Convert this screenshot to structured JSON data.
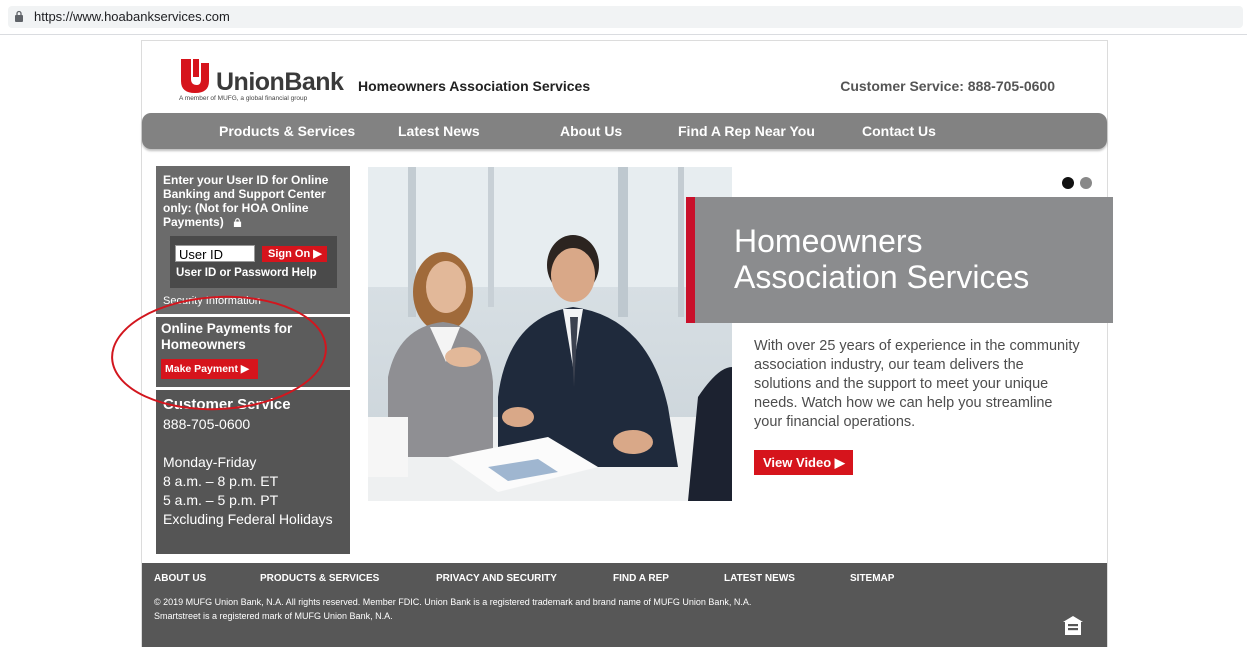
{
  "browser": {
    "url": "https://www.hoabankservices.com"
  },
  "header": {
    "logo_name": "UnionBank",
    "logo_tagline": "A member of MUFG, a global financial group",
    "title": "Homeowners Association Services",
    "customer_service": "Customer Service: 888-705-0600"
  },
  "nav": [
    {
      "label": "Products & Services"
    },
    {
      "label": "Latest News"
    },
    {
      "label": "About Us"
    },
    {
      "label": "Find A Rep Near You"
    },
    {
      "label": "Contact Us"
    }
  ],
  "login": {
    "intro": "Enter your User ID for Online Banking and Support Center only: (Not for HOA Online Payments)",
    "user_id_placeholder": "User ID",
    "sign_on": "Sign On ▶",
    "help": "User ID or Password Help",
    "security": "Security Information"
  },
  "payments": {
    "heading": "Online Payments for Homeowners",
    "button": "Make Payment ▶"
  },
  "customer_service": {
    "heading": "Customer Service",
    "phone": "888-705-0600",
    "hours": [
      "Monday-Friday",
      "8 a.m. – 8 p.m. ET",
      "5 a.m. – 5 p.m. PT",
      "Excluding Federal Holidays"
    ]
  },
  "hero": {
    "title_line1": "Homeowners",
    "title_line2": "Association Services",
    "description": "With over 25 years of experience in the community association industry, our team delivers the solutions and the support to meet your unique needs. Watch how we can help you streamline your financial operations.",
    "video_button": "View Video ▶",
    "active_slide": 1,
    "slide_count": 2
  },
  "footer": {
    "links": [
      "ABOUT US",
      "PRODUCTS & SERVICES",
      "PRIVACY AND SECURITY",
      "FIND A REP",
      "LATEST NEWS",
      "SITEMAP"
    ],
    "copyright": "© 2019 MUFG Union Bank, N.A. All rights reserved. Member FDIC. Union Bank is a registered trademark and brand name of MUFG Union Bank, N.A.",
    "smartstreet": "Smartstreet is a registered mark of MUFG Union Bank, N.A."
  },
  "colors": {
    "brand_red": "#d6141c",
    "nav_gray": "#828282",
    "panel_gray": "#6b6b6b",
    "banner_gray": "#8b8c8e"
  }
}
